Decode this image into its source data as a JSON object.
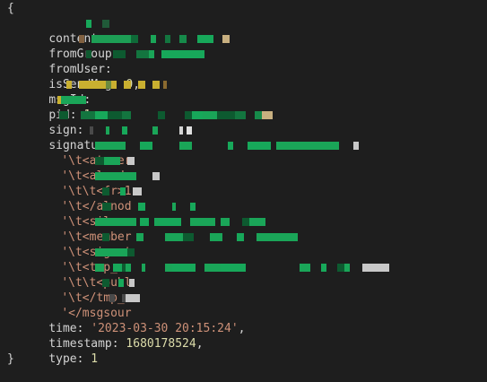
{
  "console": {
    "open_brace": "{",
    "close_brace": "}",
    "fields": {
      "content": "content:",
      "fromGroup": "fromGroup",
      "fromUser": "fromUser:",
      "isSendMsg_key": "isSendMsg:",
      "isSendMsg_value": "0",
      "msgId": "msgId:",
      "pid_key": "pid:",
      "pid_value": "1",
      "sign": "sign:",
      "signature": "signature:",
      "time_key": "time:",
      "time_value": "'2023-03-30 20:15:24'",
      "timestamp_key": "timestamp:",
      "timestamp_value": "1680178524",
      "type_key": "type:",
      "type_value": "1"
    },
    "signature_lines": [
      "'\\t<atuser",
      "'\\t<alnode",
      "'\\t\\t<fr>1",
      "'\\t</alnod",
      "'\\t<silenc",
      "'\\t<member",
      "'\\t<signat",
      "'\\t<tmp_no",
      "'\\t\\t<publ",
      "'\\t</tmp_n",
      "'</msgsour"
    ]
  },
  "colors": {
    "background": "#1e1e1e",
    "text": "#d4d4d4",
    "string": "#ce9178",
    "number": "#b5cea8",
    "timestamp": "#dcdcaa",
    "redaction_green": "#17a85a",
    "redaction_yellow": "#c9b030"
  }
}
